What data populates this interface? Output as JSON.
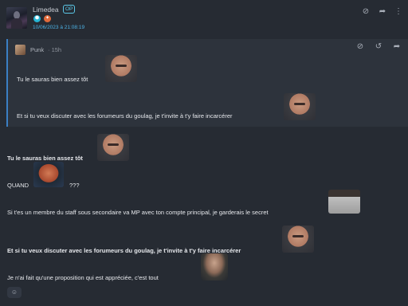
{
  "post": {
    "author": "Limedea",
    "op_badge": "OP",
    "badges": [
      {
        "name": "hexagon-badge-icon",
        "glyph": "⬢",
        "color": "#27b5d4"
      },
      {
        "name": "shield-badge-icon",
        "glyph": "✦",
        "color": "#e06a3b"
      }
    ],
    "date": "10/06/2023 à 21:08:19",
    "actions": [
      {
        "name": "hide-icon",
        "glyph": "⊘"
      },
      {
        "name": "share-icon",
        "glyph": "➦"
      },
      {
        "name": "more-icon",
        "glyph": "⋮"
      }
    ]
  },
  "quote": {
    "author": "Punk",
    "time": "· 15h",
    "actions": [
      {
        "name": "hide-icon",
        "glyph": "⊘"
      },
      {
        "name": "history-icon",
        "glyph": "↺"
      },
      {
        "name": "share-icon",
        "glyph": "➦"
      }
    ],
    "lines": [
      "Tu le sauras bien assez tôt",
      "Et si tu veux discuter avec les forumeurs du goulag, je t'invite à t'y faire incarcérer"
    ]
  },
  "body": {
    "lines": [
      "Tu le sauras bien assez tôt",
      "QUAND",
      "???",
      "Si t'es un membre du staff sous secondaire va MP avec ton compte principal, je garderais le secret",
      "Et si tu veux discuter avec les forumeurs du goulag, je t'invite à t'y faire incarcérer",
      "Je n'ai fait qu'une proposition qui est appréciée, c'est tout"
    ]
  },
  "reaction_button": {
    "icon": "add-reaction-icon",
    "glyph": "☺"
  },
  "colors": {
    "background": "#262b33",
    "quote_bg": "#2d333c",
    "accent": "#4db3e6",
    "quote_border": "#3b7fc4"
  }
}
